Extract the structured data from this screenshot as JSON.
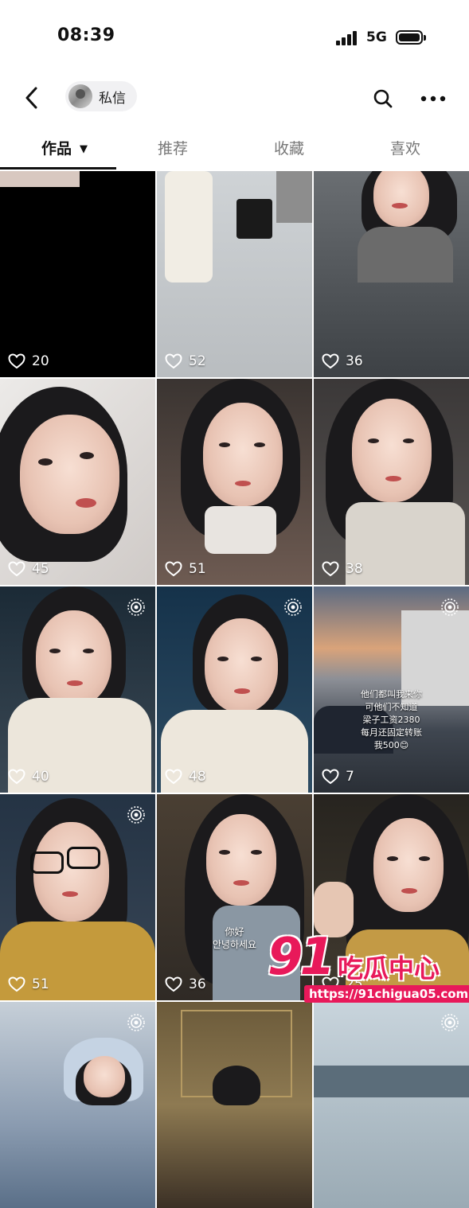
{
  "status_bar": {
    "time": "08:39",
    "network": "5G"
  },
  "header": {
    "dm_label": "私信"
  },
  "tabs": [
    {
      "label": "作品",
      "active": true
    },
    {
      "label": "推荐",
      "active": false
    },
    {
      "label": "收藏",
      "active": false
    },
    {
      "label": "喜欢",
      "active": false
    }
  ],
  "posts": [
    {
      "likes": "20",
      "live": false
    },
    {
      "likes": "52",
      "live": false
    },
    {
      "likes": "36",
      "live": false
    },
    {
      "likes": "45",
      "live": false
    },
    {
      "likes": "51",
      "live": false
    },
    {
      "likes": "38",
      "live": false
    },
    {
      "likes": "40",
      "live": true
    },
    {
      "likes": "48",
      "live": true
    },
    {
      "likes": "7",
      "live": true
    },
    {
      "likes": "51",
      "live": true
    },
    {
      "likes": "36",
      "live": false
    },
    {
      "likes": "25",
      "live": false
    },
    {
      "likes": "",
      "live": true
    },
    {
      "likes": "",
      "live": false
    },
    {
      "likes": "",
      "live": true
    }
  ],
  "post_overlays": {
    "post9_lines": [
      "他们都叫我来你",
      "可他们不知道",
      "梁子工资2380",
      "每月还固定转账",
      "我500😊"
    ],
    "post11_lines": [
      "你好",
      "안녕하세요"
    ]
  },
  "watermark": {
    "number": "91",
    "name": "吃瓜中心",
    "url": "https://91chigua05.com"
  },
  "colors": {
    "accent": "#e8195a",
    "text_primary": "#111111",
    "text_secondary": "#777777"
  }
}
